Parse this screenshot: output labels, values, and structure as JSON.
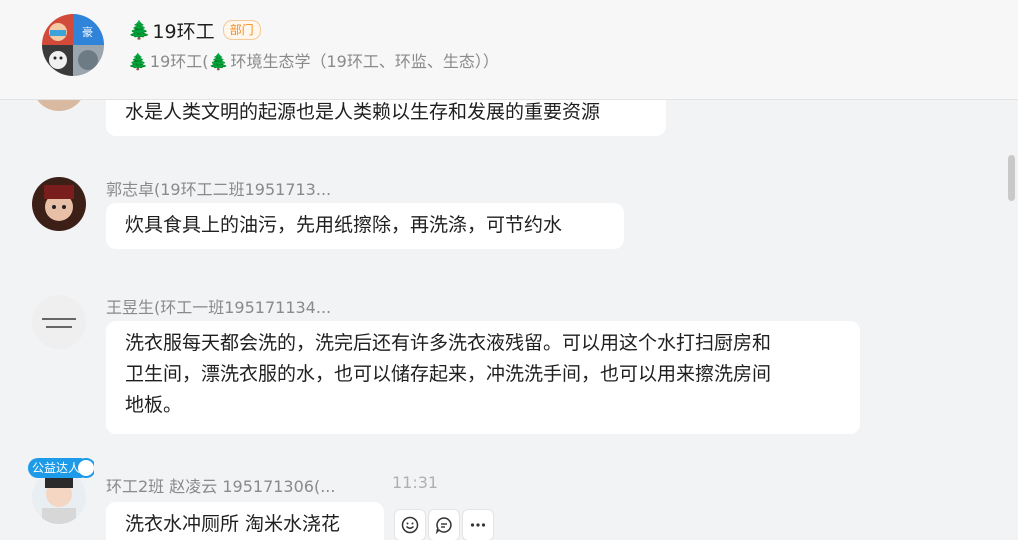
{
  "header": {
    "group_name": "19环工",
    "dept_badge": "部门",
    "subtitle": "19环工(",
    "subtitle_rest": "环境生态学（19环工、环监、生态））"
  },
  "messages": [
    {
      "text": "水是人类文明的起源也是人类赖以生存和发展的重要资源"
    },
    {
      "sender": "郭志卓(19环工二班1951713...",
      "text": "炊具食具上的油污，先用纸擦除，再洗涤，可节约水"
    },
    {
      "sender": "王昱生(环工一班195171134...",
      "text_lines": [
        "洗衣服每天都会洗的，洗完后还有许多洗衣液残留。可以用这个水打扫厨房和",
        "卫生间，漂洗衣服的水，也可以储存起来，冲洗洗手间，也可以用来擦洗房间",
        "地板。"
      ]
    },
    {
      "sender": "环工2班 赵凌云 195171306(...",
      "time": "11:31",
      "text": "洗衣水冲厕所  淘米水浇花",
      "badge": "公益达人"
    }
  ],
  "icons": {
    "tree": "tree-icon",
    "emoji": "smile-icon",
    "reply": "comment-icon",
    "more": "more-icon"
  },
  "colors": {
    "accent_orange": "#f08c1f",
    "tree_green": "#2e7d32",
    "badge_blue": "#1e9be8"
  }
}
